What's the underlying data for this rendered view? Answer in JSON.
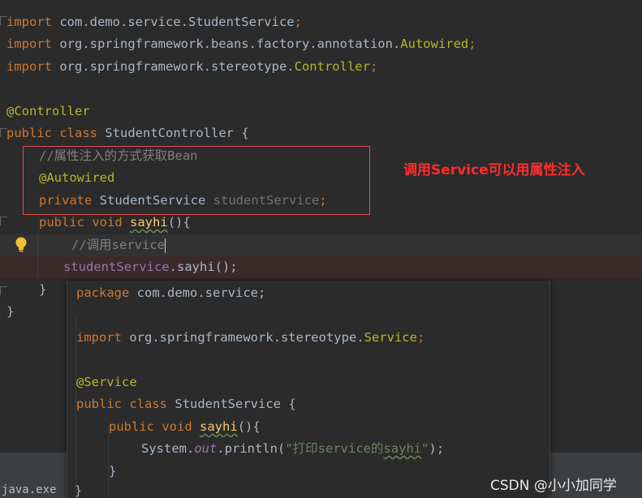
{
  "editor": {
    "import1": "com.demo.service.StudentService",
    "import2_pkg": "org.springframework.beans.factory.annotation.",
    "import2_cls": "Autowired",
    "import3_pkg": "org.springframework.stereotype.",
    "import3_cls": "Controller",
    "kw_import": "import",
    "semicolon": ";",
    "annotation_controller": "@Controller",
    "kw_public": "public",
    "kw_class": "class",
    "class_name": "StudentController {",
    "comment_inject": "//属性注入的方式获取Bean",
    "annotation_autowired": "@Autowired",
    "kw_private": "private",
    "field_type": "StudentService",
    "field_name": "studentService",
    "kw_void": "void",
    "method_sayhi": "sayhi",
    "parens_open": "(){",
    "comment_call": "//调用service",
    "call_obj": "studentService",
    "call_method": ".sayhi();",
    "close_brace": "}"
  },
  "callout": {
    "text": "调用Service可以用属性注入"
  },
  "popup": {
    "kw_package": "package",
    "package_name": "com.demo.service;",
    "import_pkg": "org.springframework.stereotype.",
    "import_cls": "Service",
    "annotation_service": "@Service",
    "class_name": "StudentService {",
    "method_name": "sayhi",
    "println_prefix": "System.",
    "println_out": "out",
    "println_mid": ".println(",
    "println_str_a": "\"打印service的",
    "println_str_b": "sayhi",
    "println_str_c": "\"",
    "println_end": ");"
  },
  "statusbar": {
    "text": "java.exe"
  },
  "watermark": {
    "text": "CSDN @小小加同学"
  },
  "colors": {
    "background": "#2b2b2b",
    "keyword": "#cc7832",
    "annotation": "#bbb529",
    "comment": "#808080",
    "field": "#9876aa",
    "method": "#ffc66d",
    "string": "#6a8759",
    "callout": "#ff2d2d"
  },
  "icons": {
    "bulb": "lightbulb-icon"
  }
}
